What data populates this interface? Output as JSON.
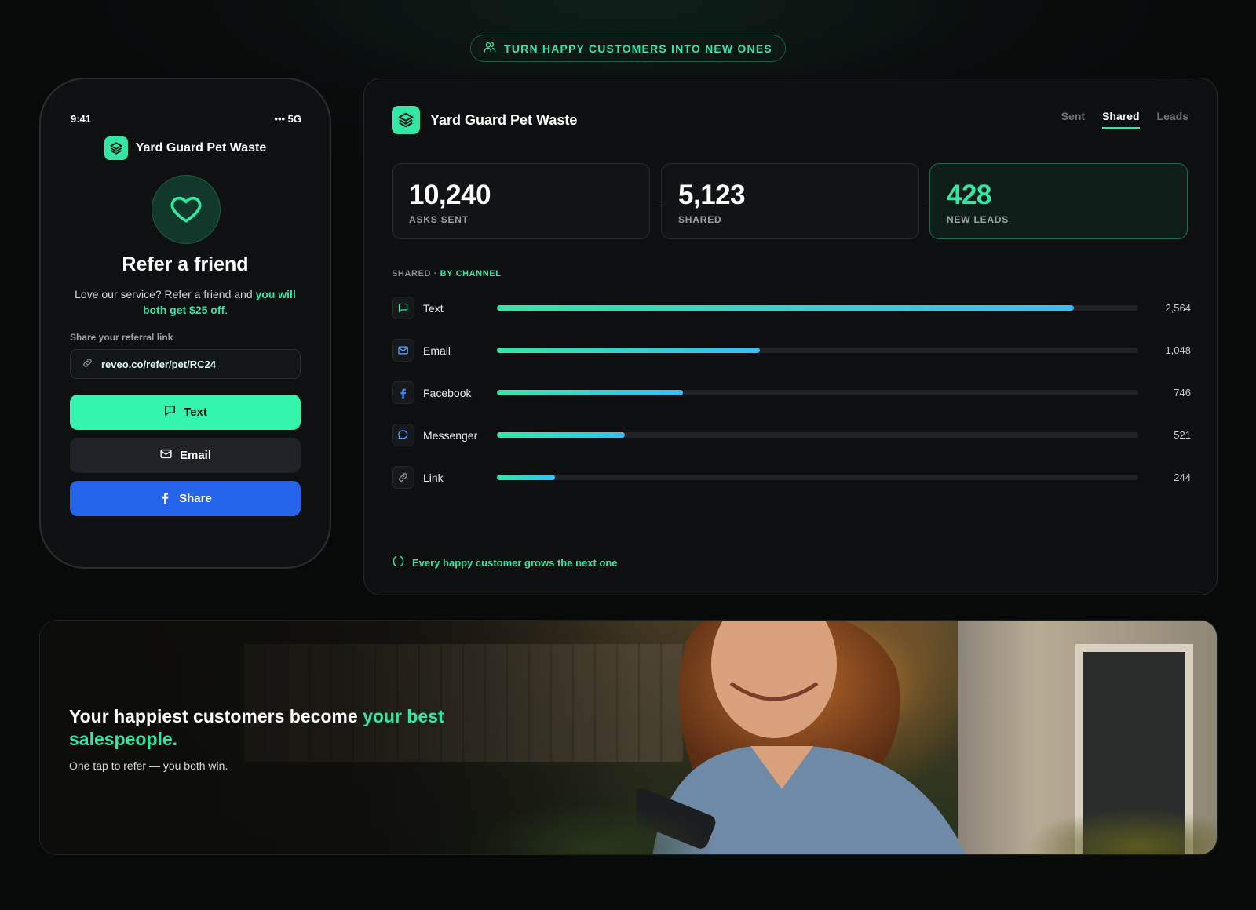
{
  "top_pill": {
    "label": "TURN HAPPY CUSTOMERS INTO NEW ONES",
    "icon": "users-icon"
  },
  "colors": {
    "accent": "#33e6a3",
    "share_blue": "#2563eb",
    "bar_end": "#38bdf8"
  },
  "phone": {
    "time": "9:41",
    "signal": "••• 5G",
    "brand": "Yard Guard Pet Waste",
    "title": "Refer a friend",
    "desc_before": "Love our service? Refer a friend and ",
    "desc_highlight": "you will both get $25 off",
    "desc_after": ".",
    "share_label": "Share your referral link",
    "referral_link": "reveo.co/refer/pet/RC24",
    "buttons": {
      "text": "Text",
      "email": "Email",
      "share": "Share"
    }
  },
  "dashboard": {
    "brand": "Yard Guard Pet Waste",
    "tabs": [
      {
        "label": "Sent",
        "active": false
      },
      {
        "label": "Shared",
        "active": true
      },
      {
        "label": "Leads",
        "active": false
      }
    ],
    "stats": [
      {
        "value": "10,240",
        "label": "ASKS SENT"
      },
      {
        "value": "5,123",
        "label": "SHARED"
      },
      {
        "value": "428",
        "label": "NEW LEADS"
      }
    ],
    "section_prefix": "SHARED · ",
    "section_highlight": "BY CHANNEL",
    "channels": [
      {
        "name": "Text",
        "value": "2,564",
        "share": 0.9,
        "icon": "message-square-icon",
        "color": "#33e6a3"
      },
      {
        "name": "Email",
        "value": "1,048",
        "share": 0.41,
        "icon": "mail-icon",
        "color": "#60a5fa"
      },
      {
        "name": "Facebook",
        "value": "746",
        "share": 0.29,
        "icon": "facebook-icon",
        "color": "#3b82f6"
      },
      {
        "name": "Messenger",
        "value": "521",
        "share": 0.2,
        "icon": "message-circle-icon",
        "color": "#60a5fa"
      },
      {
        "name": "Link",
        "value": "244",
        "share": 0.09,
        "icon": "link-icon",
        "color": "#9aa0a4"
      }
    ],
    "footer": "Every happy customer grows the next one"
  },
  "hero": {
    "headline_before": "Your happiest customers become ",
    "headline_highlight": "your best salespeople.",
    "subline": "One tap to refer — you both win."
  }
}
